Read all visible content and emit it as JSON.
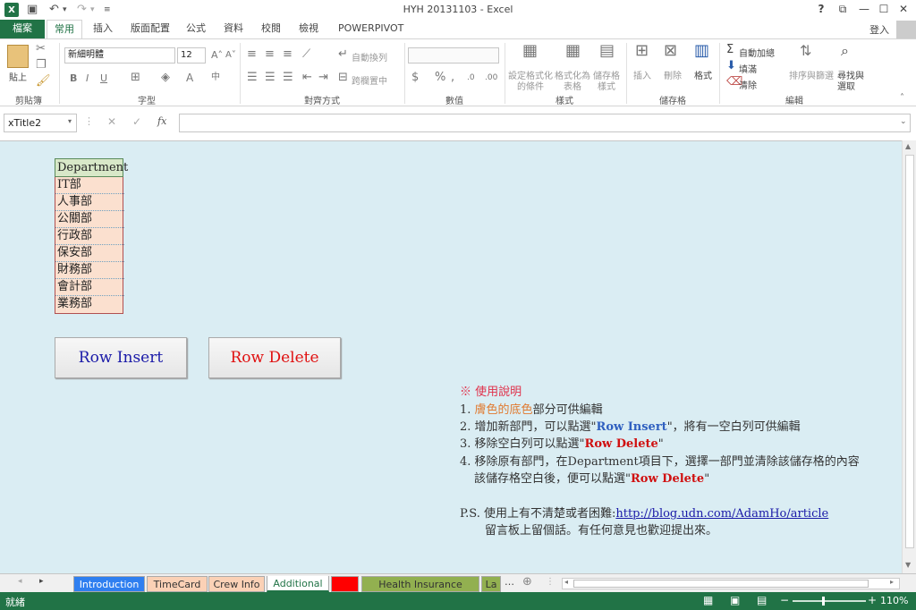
{
  "window": {
    "title": "HYH 20131103 - Excel",
    "logo": "X",
    "help": "?",
    "signin": "登入"
  },
  "qat": {
    "save": "💾",
    "undo": "↶",
    "redo": "↷"
  },
  "tabs": [
    "檔案",
    "常用",
    "插入",
    "版面配置",
    "公式",
    "資料",
    "校閱",
    "檢視",
    "POWERPIVOT"
  ],
  "ribbon": {
    "clipboard": {
      "label": "剪貼簿",
      "paste": "貼上"
    },
    "font": {
      "label": "字型",
      "name": "新細明體",
      "size": "12"
    },
    "alignment": {
      "label": "對齊方式",
      "wrap": "自動換列",
      "merge": "跨欄置中"
    },
    "number": {
      "label": "數值"
    },
    "styles": {
      "label": "樣式",
      "cond1": "設定格式化",
      "cond2": "的條件",
      "table1": "格式化為",
      "table2": "表格",
      "cell1": "儲存格",
      "cell2": "樣式"
    },
    "cells": {
      "label": "儲存格",
      "insert": "插入",
      "delete": "刪除",
      "format": "格式"
    },
    "editing": {
      "label": "編輯",
      "autosum": "自動加總",
      "fill": "填滿",
      "clear": "清除",
      "sort1": "排序與篩選",
      "find1": "尋找與",
      "find2": "選取"
    }
  },
  "formula_bar": {
    "name_box": "xTitle2",
    "fx": "fx",
    "value": ""
  },
  "sheet": {
    "header": "Department",
    "departments": [
      "IT部",
      "人事部",
      "公關部",
      "行政部",
      "保安部",
      "財務部",
      "會計部",
      "業務部"
    ],
    "buttons": {
      "insert": "Row Insert",
      "delete": "Row Delete"
    },
    "notes": {
      "title": "※ 使用說明",
      "l1_num": "1. ",
      "l1_colored": "膚色的底色",
      "l1_rest": "部分可供編輯",
      "l2_pre": "2. 增加新部門，可以點選\"",
      "l2_btn": "Row Insert",
      "l2_post": "\"，將有一空白列可供編輯",
      "l3_pre": "3. 移除空白列可以點選\"",
      "l3_btn": "Row Delete",
      "l3_post": "\"",
      "l4_a": "4. 移除原有部門，在Department項目下，選擇一部門並清除該儲存格的內容",
      "l4_b_pre": "該儲存格空白後，便可以點選\"",
      "l4_b_btn": "Row Delete",
      "l4_b_post": "\"",
      "ps_pre": "P.S. 使用上有不清楚或者困難:",
      "ps_link": "http://blog.udn.com/AdamHo/article",
      "ps_2": "留言板上留個話。有任何意見也歡迎提出來。"
    }
  },
  "sheet_tabs": [
    {
      "label": "Introduction",
      "color": "#2f7ff0",
      "text": "#ffffff"
    },
    {
      "label": "TimeCard",
      "color": "#fbd1b6",
      "text": "#333333"
    },
    {
      "label": "Crew Info",
      "color": "#fbd1b6",
      "text": "#333333"
    },
    {
      "label": "Additional",
      "color": "#ffffff",
      "text": "#217346"
    },
    {
      "label": "---",
      "color": "#ff0000",
      "text": "#ff0000"
    },
    {
      "label": "Health Insurance Range",
      "color": "#92b050",
      "text": "#333333"
    },
    {
      "label": "La",
      "color": "#92b050",
      "text": "#333333"
    }
  ],
  "status": {
    "ready": "就緒",
    "zoom": "110%"
  },
  "colors": {
    "accent": "#217346",
    "sheet_bg": "#daedf3",
    "skin": "#fbe0cf",
    "header_green": "#d8e8c8",
    "insert_blue": "#1a1aa8",
    "delete_red": "#e01010"
  }
}
